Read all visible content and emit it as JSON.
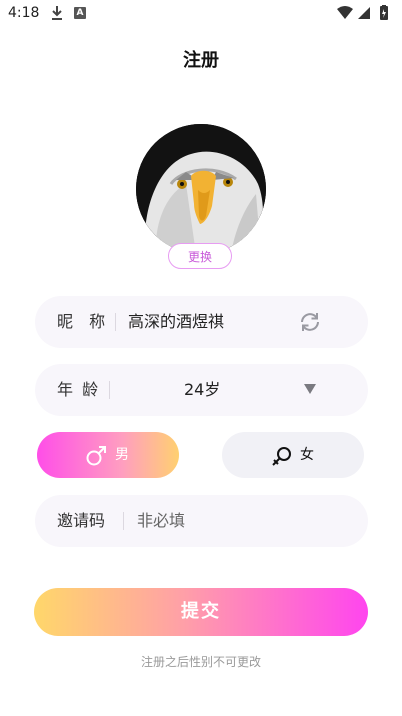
{
  "status_bar": {
    "time": "4:18",
    "download_icon": "download-icon",
    "a_label": "A"
  },
  "header": {
    "title": "注册"
  },
  "avatar": {
    "change_label": "更换"
  },
  "nickname": {
    "label": "昵  称",
    "value": "高深的酒煜祺",
    "icon": "refresh-icon"
  },
  "age": {
    "label": "年 龄",
    "value": "24岁",
    "icon": "dropdown-triangle-icon"
  },
  "gender": {
    "male_label": "男",
    "female_label": "女",
    "selected": "男",
    "male_color": "#ff4ee8",
    "female_bg": "#f1f1f6"
  },
  "invite": {
    "label": "邀请码",
    "placeholder": "非必填"
  },
  "submit": {
    "label": "提交"
  },
  "footnote": "注册之后性别不可更改",
  "colors": {
    "accent_pink": "#ff45ef",
    "accent_yellow": "#ffd76a",
    "row_bg": "#f8f6fb"
  }
}
